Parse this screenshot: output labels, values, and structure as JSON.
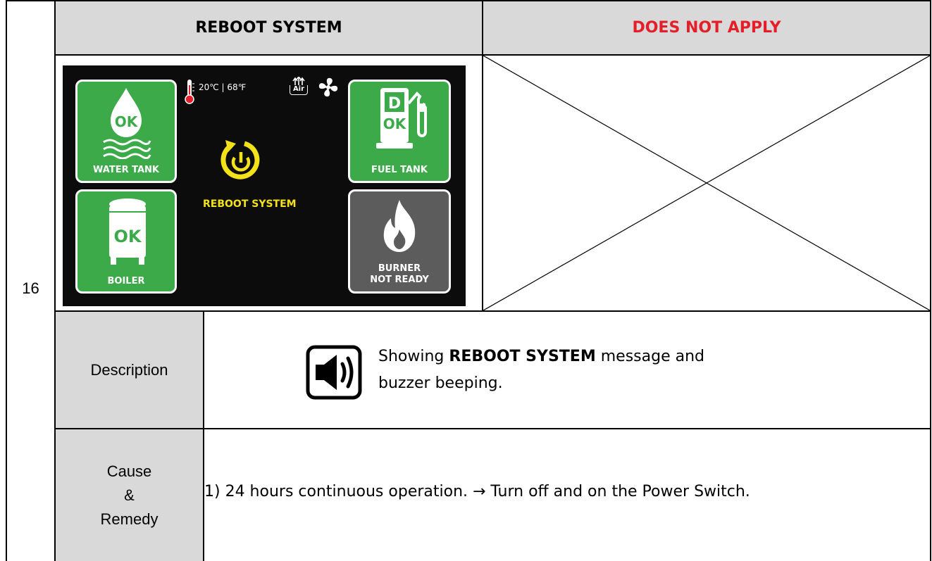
{
  "row_number": "16",
  "header": {
    "left_title": "REBOOT SYSTEM",
    "right_title": "DOES NOT APPLY",
    "right_title_color": "#e3202a"
  },
  "screen": {
    "temperature_readout": "20℃ | 68℉",
    "air_label": "Air",
    "reboot_label": "REBOOT SYSTEM",
    "tiles": {
      "water_tank": {
        "status": "OK",
        "label": "WATER TANK"
      },
      "fuel_tank": {
        "fuel_letter": "D",
        "status": "OK",
        "label": "FUEL TANK"
      },
      "boiler": {
        "status": "OK",
        "label": "BOILER"
      },
      "burner": {
        "label_line1": "BURNER",
        "label_line2": "NOT READY"
      }
    },
    "colors": {
      "tile_green": "#3caa49",
      "tile_gray": "#5c5c5c",
      "reboot_yellow": "#f3e11a"
    }
  },
  "description": {
    "label": "Description",
    "text_before": "Showing ",
    "text_bold": "REBOOT SYSTEM",
    "text_after": " message and buzzer beeping.",
    "icon": "speaker-icon"
  },
  "cause": {
    "label_line1": "Cause",
    "label_line2": "&",
    "label_line3": "Remedy",
    "text": "1) 24 hours continuous operation.  → Turn off and on the Power Switch."
  }
}
